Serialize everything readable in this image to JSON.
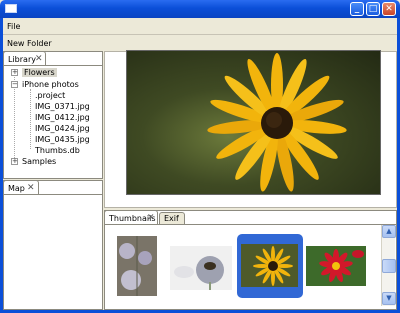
{
  "menu": {
    "file": "File"
  },
  "toolbar": {
    "new_folder": "New Folder"
  },
  "library": {
    "tab_label": "Library",
    "tree": {
      "flowers": "Flowers",
      "iphone": "iPhone photos",
      "files": [
        ".project",
        "IMG_0371.jpg",
        "IMG_0412.jpg",
        "IMG_0424.jpg",
        "IMG_0435.jpg",
        "Thumbs.db"
      ],
      "samples": "Samples"
    }
  },
  "map": {
    "tab_label": "Map"
  },
  "thumbnails": {
    "tab_label": "Thumbnails",
    "exif_label": "Exif"
  },
  "colors": {
    "titlebar": "#0b4fd8",
    "selection": "#3168d5",
    "petal": "#f2b40c",
    "center": "#2a1a0a"
  },
  "icons": {
    "close": "close-icon",
    "scroll_up": "chevron-up-icon",
    "scroll_down": "chevron-down-icon"
  }
}
